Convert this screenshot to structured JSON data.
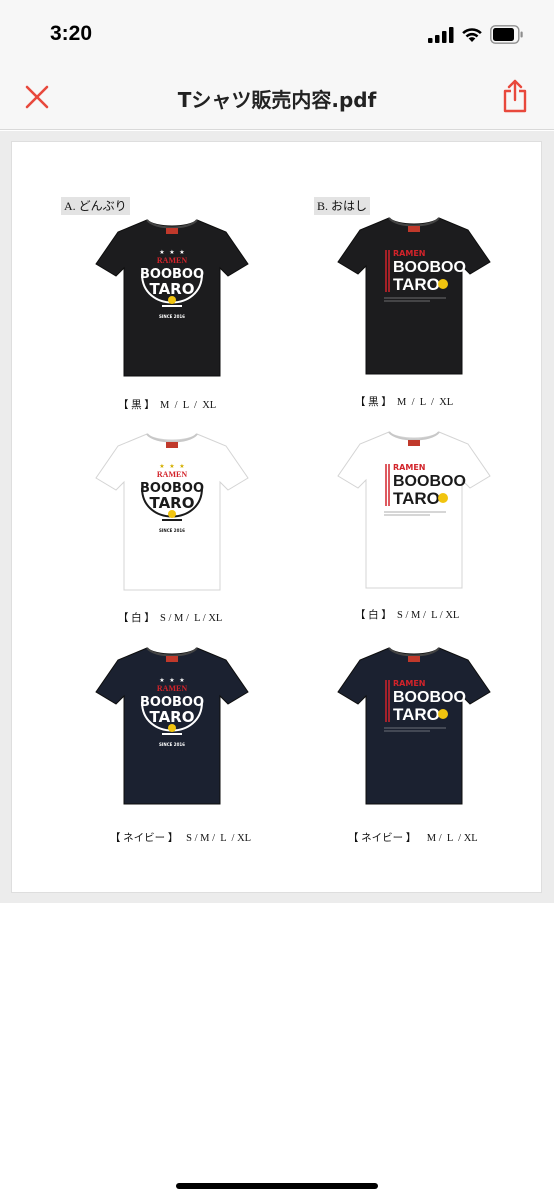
{
  "status_bar": {
    "time": "3:20"
  },
  "nav": {
    "title": "Tシャツ販売内容.pdf",
    "accent_color": "#e8483c"
  },
  "document": {
    "section_a_label": "A. どんぶり",
    "section_b_label": "B. おはし",
    "shirts": [
      {
        "design": "donburi",
        "color": "#1c1c1e",
        "caption": "【 黒 】  M  /  L  /  XL"
      },
      {
        "design": "ohashi",
        "color": "#1c1c1e",
        "caption": "【 黒 】  M  /  L  /  XL"
      },
      {
        "design": "donburi",
        "color": "#ffffff",
        "caption": "【 白 】  S / M /  L / XL"
      },
      {
        "design": "ohashi",
        "color": "#ffffff",
        "caption": "【 白 】  S / M /  L / XL"
      },
      {
        "design": "donburi",
        "color": "#1b2130",
        "caption": "【 ネイビー 】   S / M /  L  / XL"
      },
      {
        "design": "ohashi",
        "color": "#1b2130",
        "caption": "【 ネイビー 】    M /  L  / XL"
      }
    ],
    "logo_text": {
      "ramen": "RAMEN",
      "booboo": "BOOBOO",
      "taro": "TARO",
      "since": "SINCE 2016"
    }
  }
}
